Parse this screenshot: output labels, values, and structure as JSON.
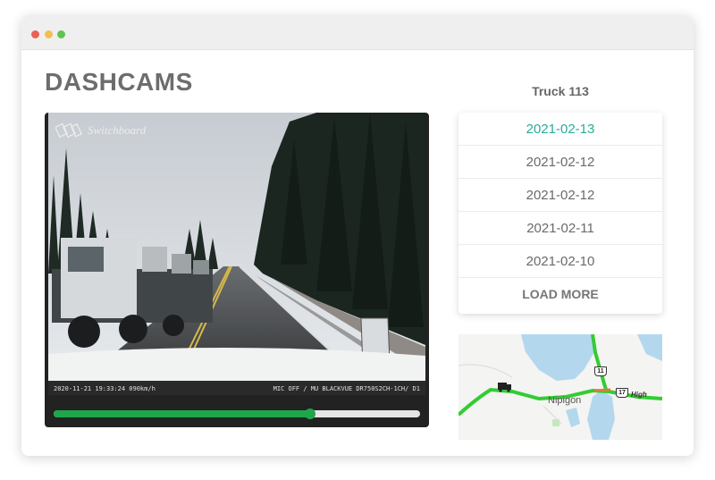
{
  "window": {
    "controls": [
      "close",
      "minimize",
      "maximize"
    ]
  },
  "page": {
    "title": "DASHCAMS"
  },
  "video": {
    "brand": "Switchboard",
    "overlay_left": "2020-11-21 19:33:24  090km/h",
    "overlay_right": "MIC OFF / MU  BLACKVUE DR750S2CH-1CH/ D1",
    "progress_fraction": 0.7
  },
  "sidebar": {
    "truck_title": "Truck 113",
    "dates": [
      {
        "label": "2021-02-13",
        "active": true
      },
      {
        "label": "2021-02-12",
        "active": false
      },
      {
        "label": "2021-02-12",
        "active": false
      },
      {
        "label": "2021-02-11",
        "active": false
      },
      {
        "label": "2021-02-10",
        "active": false
      }
    ],
    "load_more": "LOAD MORE"
  },
  "map": {
    "town": "Nipigon",
    "highway_11": "11",
    "highway_17": "17",
    "highway_label": "High",
    "route_color": "#33cc33",
    "water_color": "#b3d8ee",
    "truck_icon": "truck-icon"
  },
  "colors": {
    "accent": "#2bab9a",
    "progress": "#1fa64a"
  }
}
